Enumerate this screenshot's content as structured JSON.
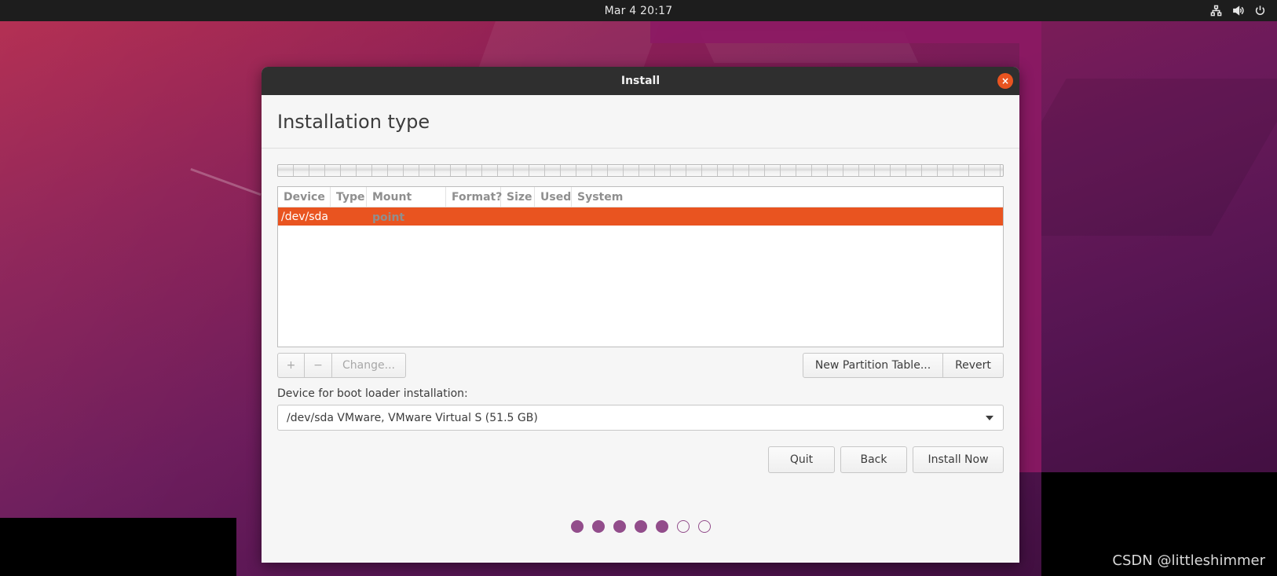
{
  "topbar": {
    "clock": "Mar 4  20:17",
    "tray_icons": [
      "network-icon",
      "volume-icon",
      "power-icon"
    ]
  },
  "window": {
    "title": "Install",
    "close_glyph": "×"
  },
  "page": {
    "title": "Installation type"
  },
  "partition_table": {
    "columns": [
      "Device",
      "Type",
      "Mount point",
      "Format?",
      "Size",
      "Used",
      "System"
    ],
    "rows": [
      {
        "device": "/dev/sda",
        "selected": true
      }
    ]
  },
  "partition_controls": {
    "add_glyph": "+",
    "remove_glyph": "−",
    "change_label": "Change...",
    "new_table_label": "New Partition Table...",
    "revert_label": "Revert"
  },
  "boot_loader": {
    "label": "Device for boot loader installation:",
    "selected": "/dev/sda VMware, VMware Virtual S (51.5 GB)"
  },
  "actions": {
    "quit_label": "Quit",
    "back_label": "Back",
    "install_label": "Install Now"
  },
  "progress": {
    "total_steps": 7,
    "completed_steps": 5
  },
  "colors": {
    "accent": "#e95420",
    "progress_dot": "#924d8b"
  },
  "watermark": "CSDN @littleshimmer"
}
